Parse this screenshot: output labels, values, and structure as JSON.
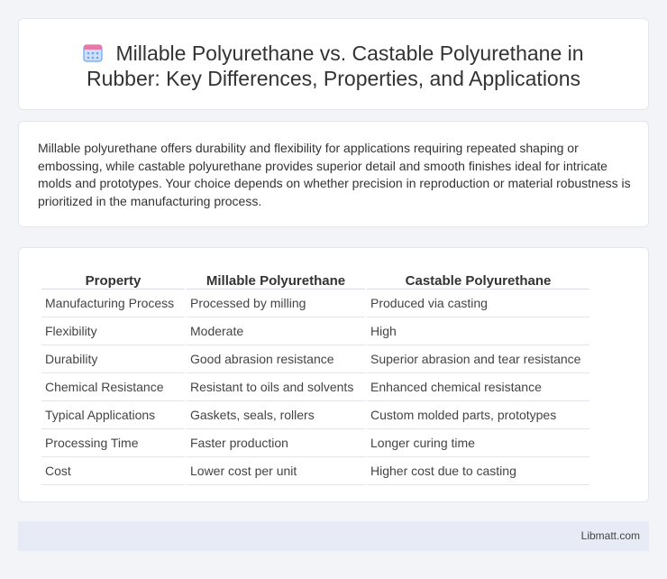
{
  "header": {
    "icon": "calendar-icon",
    "title_line1": "Millable Polyurethane vs. Castable Polyurethane in",
    "title_line2": "Rubber: Key Differences, Properties, and Applications"
  },
  "summary": {
    "text": "Millable polyurethane offers durability and flexibility for applications requiring repeated shaping or embossing, while castable polyurethane provides superior detail and smooth finishes ideal for intricate molds and prototypes. Your choice depends on whether precision in reproduction or material robustness is prioritized in the manufacturing process."
  },
  "table": {
    "headers": [
      "Property",
      "Millable Polyurethane",
      "Castable Polyurethane"
    ],
    "rows": [
      [
        "Manufacturing Process",
        "Processed by milling",
        "Produced via casting"
      ],
      [
        "Flexibility",
        "Moderate",
        "High"
      ],
      [
        "Durability",
        "Good abrasion resistance",
        "Superior abrasion and tear resistance"
      ],
      [
        "Chemical Resistance",
        "Resistant to oils and solvents",
        "Enhanced chemical resistance"
      ],
      [
        "Typical Applications",
        "Gaskets, seals, rollers",
        "Custom molded parts, prototypes"
      ],
      [
        "Processing Time",
        "Faster production",
        "Longer curing time"
      ],
      [
        "Cost",
        "Lower cost per unit",
        "Higher cost due to casting"
      ]
    ]
  },
  "footer": {
    "brand": "Libmatt.com"
  },
  "colors": {
    "background": "#f2f4f8",
    "card": "#ffffff",
    "footer": "#e6ebf5",
    "icon_blue": "#6aa3f0",
    "icon_pink": "#e97aa8"
  }
}
